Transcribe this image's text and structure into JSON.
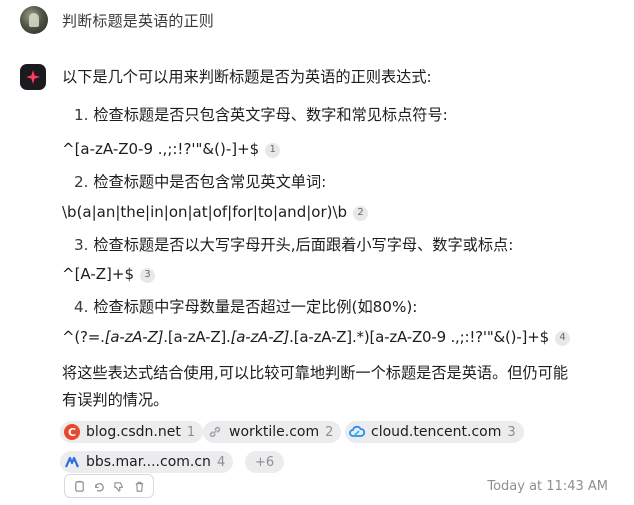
{
  "user": {
    "message": "判断标题是英语的正则"
  },
  "answer": {
    "intro": "以下是几个可以用来判断标题是否为英语的正则表达式:",
    "items": [
      {
        "num": "1.",
        "text": "检查标题是否只包含英文字母、数字和常见标点符号:",
        "code": "^[a-zA-Z0-9 .,;:!?'\"&()-]+$",
        "cite": "1"
      },
      {
        "num": "2.",
        "text": "检查标题中是否包含常见英文单词:",
        "code": "\\b(a|an|the|in|on|at|of|for|to|and|or)\\b",
        "cite": "2"
      },
      {
        "num": "3.",
        "text": "检查标题是否以大写字母开头,后面跟着小写字母、数字或标点:",
        "code": "^[A-Z]+$",
        "cite": "3"
      },
      {
        "num": "4.",
        "text": "检查标题中字母数量是否超过一定比例(如80%):",
        "code_parts": [
          "^(?=.",
          "[a-zA-Z]",
          ".",
          "[a-zA-Z]",
          ".",
          "[a-zA-Z]",
          ".",
          "[a-zA-Z]",
          ".*)[a-zA-Z0-9 .,;:!?'\"&()-]+$"
        ],
        "cite": "4"
      }
    ],
    "conclusion_line1": "将这些表达式结合使用,可以比较可靠地判断一个标题是否是英语。但仍可能",
    "conclusion_line2": "有误判的情况。"
  },
  "sources": [
    {
      "label": "blog.csdn.net",
      "num": "1",
      "icon": "csdn-icon",
      "color": "#e8482e"
    },
    {
      "label": "worktile.com",
      "num": "2",
      "icon": "link-icon",
      "color": "#b0b0b5"
    },
    {
      "label": "cloud.tencent.com",
      "num": "3",
      "icon": "tencent-cloud-icon",
      "color": "#2d8cf0"
    },
    {
      "label": "bbs.mar....com.cn",
      "num": "4",
      "icon": "marsdn-icon",
      "color": "#2f6fe0"
    }
  ],
  "more_sources": "+6",
  "timestamp": "Today at 11:43 AM"
}
